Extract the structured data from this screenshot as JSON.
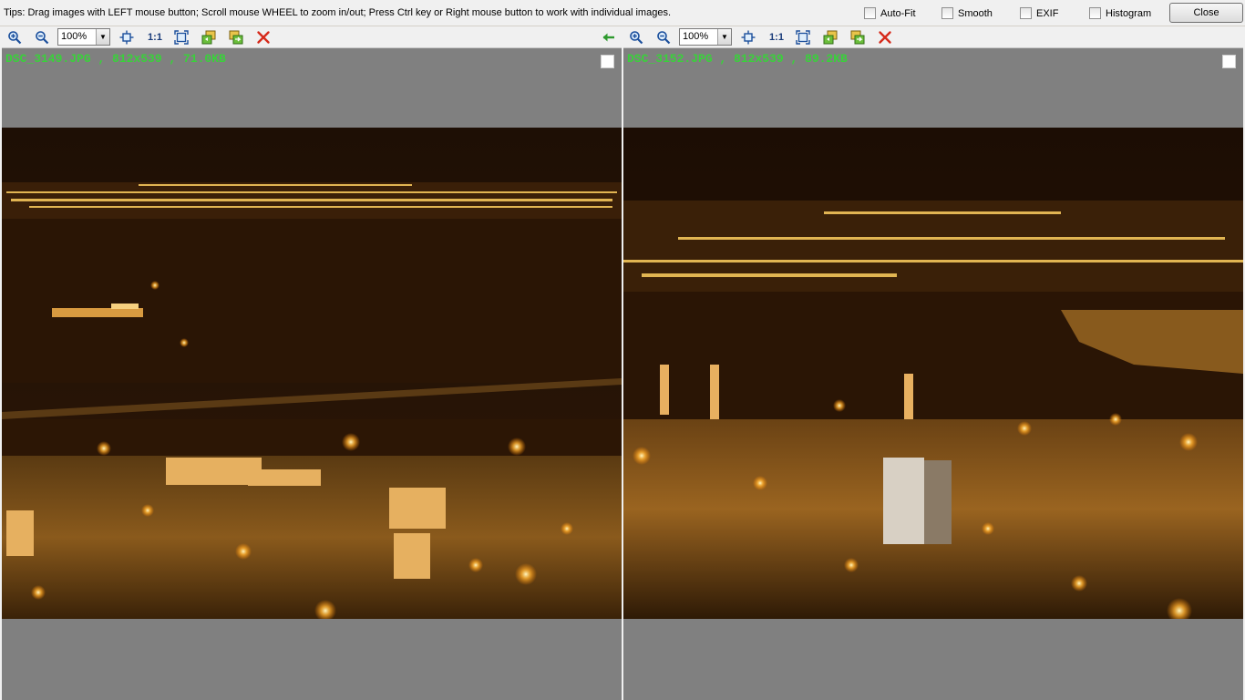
{
  "tips": "Tips: Drag images with LEFT mouse button; Scroll mouse WHEEL to zoom in/out; Press Ctrl key or Right mouse button to work with individual images.",
  "options": {
    "autofit": "Auto-Fit",
    "smooth": "Smooth",
    "exif": "EXIF",
    "histogram": "Histogram"
  },
  "close_label": "Close",
  "toolbar": {
    "zoom_in_icon": "zoom-in-icon",
    "zoom_out_icon": "zoom-out-icon",
    "fit_icon": "fit-to-window-icon",
    "one_to_one": "1:1",
    "fullscreen_icon": "full-screen-icon",
    "copy_icon": "copy-image-icon",
    "save_icon": "save-image-icon",
    "remove_icon": "remove-image-icon",
    "sync_icon": "sync-left-arrow-icon"
  },
  "panes": [
    {
      "zoom": "100%",
      "file_info": "DSC_3149.JPG , 812x539 , 71.0KB"
    },
    {
      "zoom": "100%",
      "file_info": "DSC_3152.JPG , 812x539 , 89.2KB"
    }
  ],
  "colors": {
    "filename_text": "#39d13a",
    "pane_background": "#808080",
    "remove_icon": "#d62a1a",
    "sync_arrow": "#2e9a2e"
  }
}
